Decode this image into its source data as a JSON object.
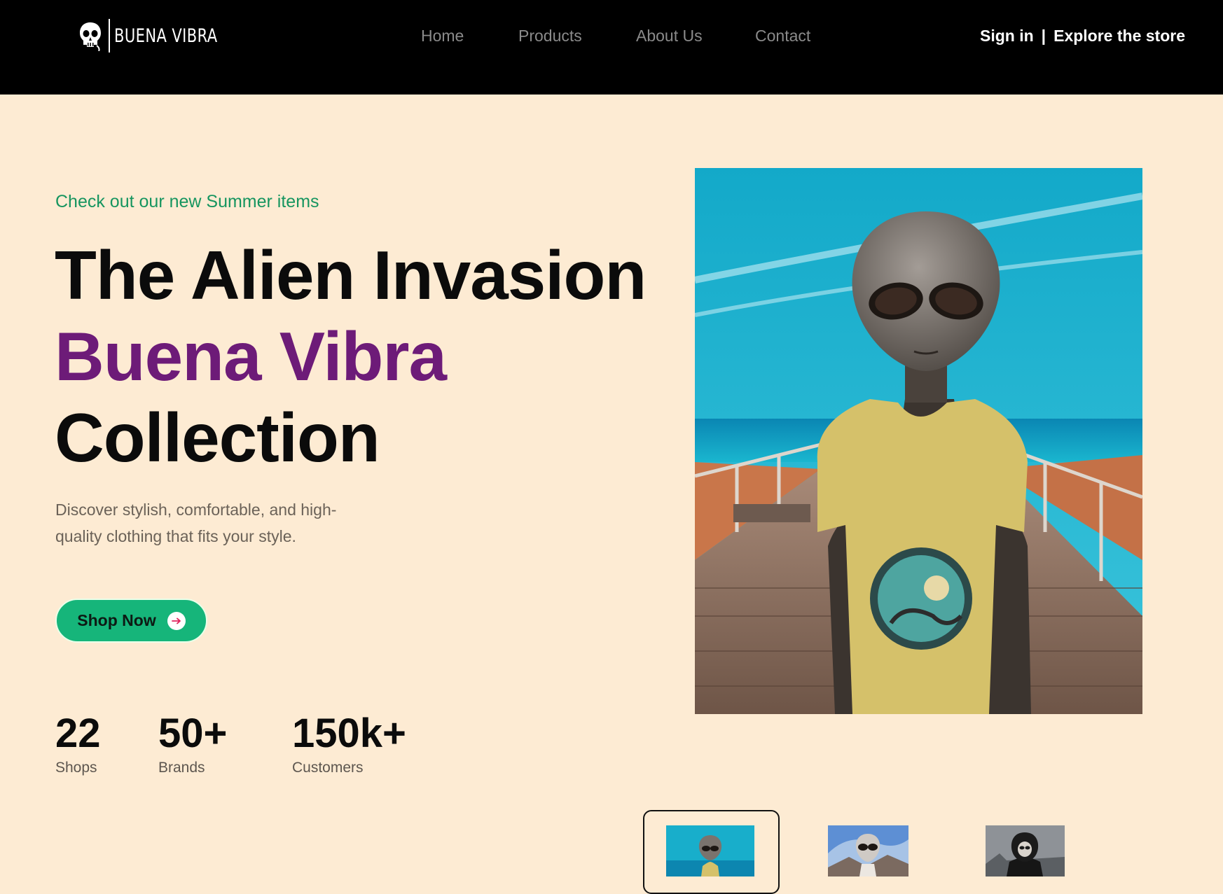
{
  "brand": {
    "name": "BUENA VIBRA"
  },
  "nav": {
    "items": [
      "Home",
      "Products",
      "About Us",
      "Contact"
    ]
  },
  "header_actions": {
    "sign_in": "Sign in",
    "separator": "|",
    "explore": "Explore the store"
  },
  "hero": {
    "eyebrow": "Check out our new Summer items",
    "headline_line1": "The Alien Invasion",
    "headline_line2": "Buena Vibra",
    "headline_line3": "Collection",
    "description": "Discover stylish, comfortable, and high-quality clothing that fits your style.",
    "cta_label": "Shop Now"
  },
  "stats": [
    {
      "value": "22",
      "label": "Shops"
    },
    {
      "value": "50+",
      "label": "Brands"
    },
    {
      "value": "150k+",
      "label": "Customers"
    }
  ],
  "colors": {
    "background": "#fdebd3",
    "header": "#000000",
    "accent_green": "#16b57a",
    "eyebrow_green": "#16955f",
    "accent_purple": "#6d1b78"
  },
  "icons": {
    "logo": "skull-icon",
    "cta": "arrow-right-icon"
  },
  "thumbnails": {
    "selected_index": 0,
    "count": 3
  }
}
